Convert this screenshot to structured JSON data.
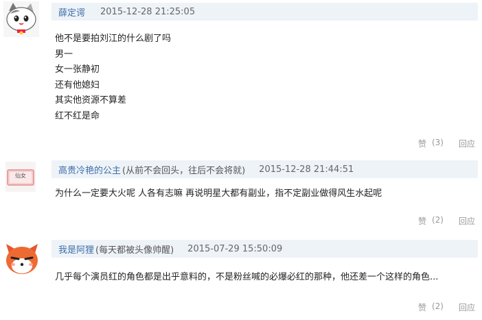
{
  "comments": [
    {
      "author": "薛定谔",
      "note": "",
      "time": "2015-12-28 21:25:05",
      "lines": [
        "他不是要拍刘江的什么剧了吗",
        "男一",
        "女一张静初",
        "还有他媳妇",
        "其实他资源不算差",
        "红不红是命"
      ],
      "like_label": "赞",
      "like_count": "(3)",
      "reply_label": "回应",
      "avatar_icon": "cat-avatar-icon"
    },
    {
      "author": "高贵冷艳的公主",
      "note": "(从前不会回头，往后不会将就)",
      "time": "2015-12-28 21:44:51",
      "lines": [
        "为什么一定要大火呢 人各有志嘛 再说明星大都有副业，指不定副业做得风生水起呢"
      ],
      "like_label": "赞",
      "like_count": "(2)",
      "reply_label": "回应",
      "avatar_icon": "card-avatar-icon",
      "avatar_text": "仙女"
    },
    {
      "author": "我是阿狸",
      "note": "(每天都被头像帅醒)",
      "time": "2015-07-29 15:50:09",
      "lines": [
        "几乎每个演员红的角色都是出乎意料的，不是粉丝喊的必爆必红的那种，他还差一个这样的角色..."
      ],
      "like_label": "赞",
      "like_count": "(2)",
      "reply_label": "回应",
      "avatar_icon": "fox-avatar-icon"
    }
  ],
  "colors": {
    "meta_bg": "#eef3f8",
    "author": "#3d6ea8",
    "muted": "#999999"
  }
}
